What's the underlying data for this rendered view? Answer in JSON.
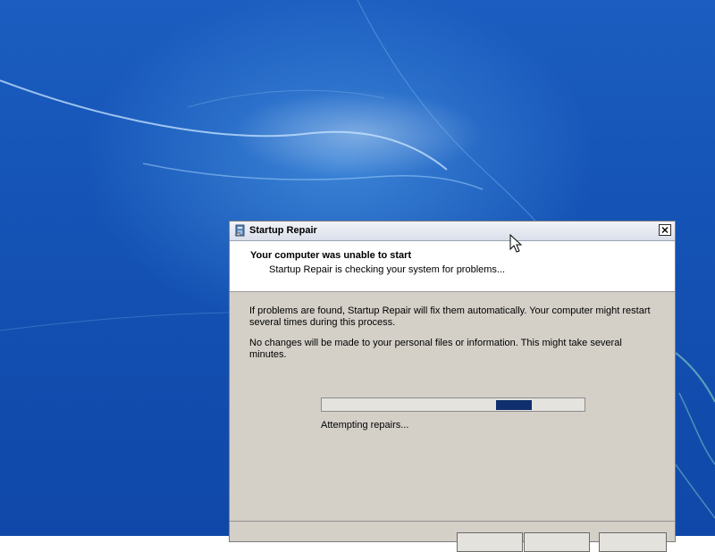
{
  "window": {
    "title": "Startup Repair",
    "icon": "startup-repair-icon",
    "close_icon": "close-icon"
  },
  "header": {
    "title": "Your computer was unable to start",
    "subtitle": "Startup Repair is checking your system for problems..."
  },
  "body": {
    "paragraph1": "If problems are found, Startup Repair will fix them automatically. Your computer might restart several times during this process.",
    "paragraph2": "No changes will be made to your personal files or information. This might take several minutes."
  },
  "progress": {
    "mode": "indeterminate",
    "block_position": 0.73,
    "status": "Attempting repairs..."
  },
  "colors": {
    "desktop_blue": "#1452b4",
    "dialog_gray": "#d4d0c8",
    "progress_fill": "#0f2f6e"
  }
}
